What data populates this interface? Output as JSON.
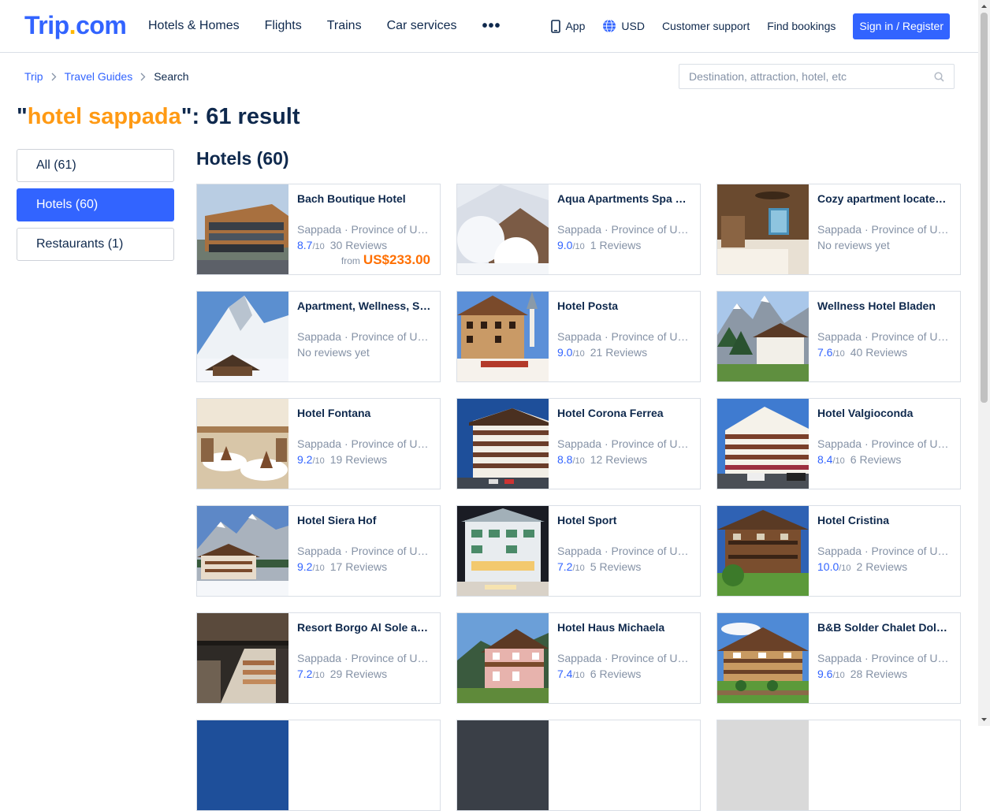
{
  "header": {
    "logo_main": "Trip",
    "logo_dot": ".",
    "logo_tld": "com",
    "nav": [
      "Hotels & Homes",
      "Flights",
      "Trains",
      "Car services"
    ],
    "more_label": "•••",
    "app_label": "App",
    "currency": "USD",
    "support": "Customer support",
    "bookings": "Find bookings",
    "signin": "Sign in / Register"
  },
  "breadcrumb": {
    "home": "Trip",
    "guides": "Travel Guides",
    "current": "Search"
  },
  "search": {
    "placeholder": "Destination, attraction, hotel, etc"
  },
  "title": {
    "q_open": "\"",
    "keyword": "hotel sappada",
    "q_close": "\"",
    "count_text": ": 61 result"
  },
  "filters": [
    {
      "label": "All (61)",
      "active": false
    },
    {
      "label": "Hotels (60)",
      "active": true
    },
    {
      "label": "Restaurants (1)",
      "active": false
    }
  ],
  "section_title": "Hotels (60)",
  "out_of": "/10",
  "reviews_suffix": "Reviews",
  "price_from": "from",
  "hotels": [
    {
      "name": "Bach Boutique Hotel",
      "location": "Sappada · Province of Udine",
      "score": "8.7",
      "reviews": "30",
      "price": "US$233.00",
      "theme": "modern"
    },
    {
      "name": "Aqua Apartments Spa & Wellness",
      "location": "Sappada · Province of Udine",
      "score": "9.0",
      "reviews": "1",
      "theme": "snowtree"
    },
    {
      "name": "Cozy apartment located in Sappada",
      "location": "Sappada · Province of Udine",
      "no_reviews": "No reviews yet",
      "theme": "room"
    },
    {
      "name": "Apartment, Wellness, Sappada",
      "location": "Sappada · Province of Udine",
      "no_reviews": "No reviews yet",
      "theme": "snowmount"
    },
    {
      "name": "Hotel Posta",
      "location": "Sappada · Province of Udine",
      "score": "9.0",
      "reviews": "21",
      "theme": "village"
    },
    {
      "name": "Wellness Hotel Bladen",
      "location": "Sappada · Province of Udine",
      "score": "7.6",
      "reviews": "40",
      "theme": "alps"
    },
    {
      "name": "Hotel Fontana",
      "location": "Sappada · Province of Udine",
      "score": "9.2",
      "reviews": "19",
      "theme": "dining"
    },
    {
      "name": "Hotel Corona Ferrea",
      "location": "Sappada · Province of Udine",
      "score": "8.8",
      "reviews": "12",
      "theme": "tallhotel"
    },
    {
      "name": "Hotel Valgioconda",
      "location": "Sappada · Province of Udine",
      "score": "8.4",
      "reviews": "6",
      "theme": "tallhotel2"
    },
    {
      "name": "Hotel Siera Hof",
      "location": "Sappada · Province of Udine",
      "score": "9.2",
      "reviews": "17",
      "theme": "snowmount2"
    },
    {
      "name": "Hotel Sport",
      "location": "Sappada · Province of Udine",
      "score": "7.2",
      "reviews": "5",
      "theme": "night"
    },
    {
      "name": "Hotel Cristina",
      "location": "Sappada · Province of Udine",
      "score": "10.0",
      "reviews": "2",
      "theme": "chalet"
    },
    {
      "name": "Resort Borgo Al Sole and Spa",
      "location": "Sappada · Province of Udine",
      "score": "7.2",
      "reviews": "29",
      "theme": "lobby"
    },
    {
      "name": "Hotel Haus Michaela",
      "location": "Sappada · Province of Udine",
      "score": "7.4",
      "reviews": "6",
      "theme": "pinkhouse"
    },
    {
      "name": "B&B Solder Chalet Dolomiten",
      "location": "Sappada · Province of Udine",
      "score": "9.6",
      "reviews": "28",
      "theme": "woodchalet"
    }
  ]
}
